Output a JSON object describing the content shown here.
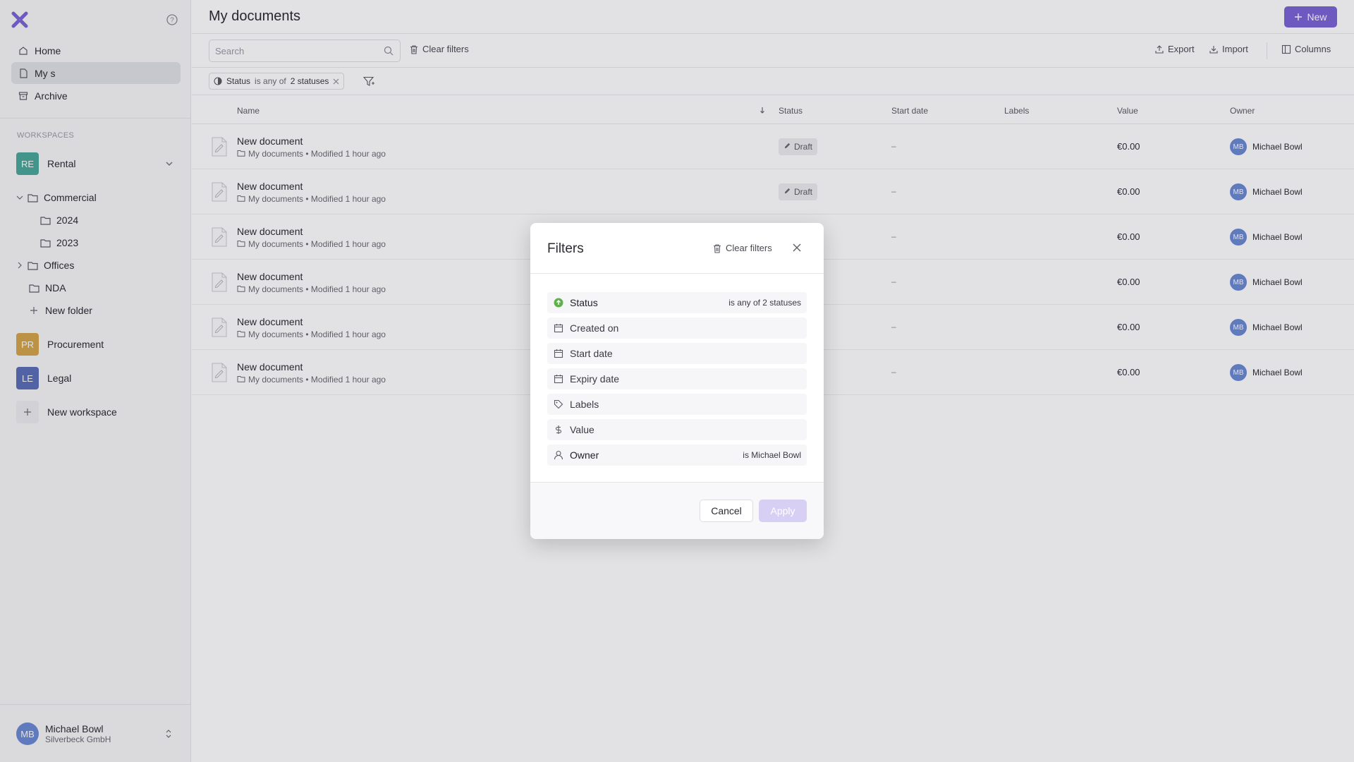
{
  "sidebar": {
    "nav": [
      {
        "label": "Home",
        "icon": "home-icon"
      },
      {
        "label": "My s",
        "icon": "document-icon",
        "active": true
      },
      {
        "label": "Archive",
        "icon": "archive-icon"
      }
    ],
    "workspaces_label": "WORKSPACES",
    "workspaces": [
      {
        "initials": "RE",
        "name": "Rental",
        "color": "#4aa89a"
      },
      {
        "initials": "PR",
        "name": "Procurement",
        "color": "#d4a64a"
      },
      {
        "initials": "LE",
        "name": "Legal",
        "color": "#5a6fb8"
      }
    ],
    "folders": {
      "commercial": "Commercial",
      "y2024": "2024",
      "y2023": "2023",
      "offices": "Offices",
      "nda": "NDA",
      "new_folder": "New folder"
    },
    "new_workspace": "New workspace",
    "user": {
      "initials": "MB",
      "name": "Michael Bowl",
      "company": "Silverbeck GmbH"
    }
  },
  "header": {
    "title": "My documents",
    "new_label": "New"
  },
  "toolbar": {
    "search_placeholder": "Search",
    "clear_filters": "Clear filters",
    "export": "Export",
    "import": "Import",
    "columns": "Columns"
  },
  "active_filter": {
    "field": "Status",
    "op": "is any of",
    "value": "2 statuses"
  },
  "table": {
    "columns": {
      "name": "Name",
      "status": "Status",
      "start_date": "Start date",
      "labels": "Labels",
      "value": "Value",
      "owner": "Owner"
    },
    "rows": [
      {
        "name": "New document",
        "meta": "My documents • Modified 1 hour ago",
        "status": "Draft",
        "start": "–",
        "value": "€0.00",
        "owner_initials": "MB",
        "owner": "Michael Bowl"
      },
      {
        "name": "New document",
        "meta": "My documents • Modified 1 hour ago",
        "status": "Draft",
        "start": "–",
        "value": "€0.00",
        "owner_initials": "MB",
        "owner": "Michael Bowl"
      },
      {
        "name": "New document",
        "meta": "My documents • Modified 1 hour ago",
        "status": "",
        "start": "–",
        "value": "€0.00",
        "owner_initials": "MB",
        "owner": "Michael Bowl"
      },
      {
        "name": "New document",
        "meta": "My documents • Modified 1 hour ago",
        "status": "",
        "start": "–",
        "value": "€0.00",
        "owner_initials": "MB",
        "owner": "Michael Bowl"
      },
      {
        "name": "New document",
        "meta": "My documents • Modified 1 hour ago",
        "status": "",
        "start": "–",
        "value": "€0.00",
        "owner_initials": "MB",
        "owner": "Michael Bowl"
      },
      {
        "name": "New document",
        "meta": "My documents • Modified 1 hour ago",
        "status": "",
        "start": "–",
        "value": "€0.00",
        "owner_initials": "MB",
        "owner": "Michael Bowl"
      }
    ]
  },
  "modal": {
    "title": "Filters",
    "clear_filters": "Clear filters",
    "filters": [
      {
        "label": "Status",
        "icon": "status-icon",
        "value": "is any of 2 statuses",
        "active": true
      },
      {
        "label": "Created on",
        "icon": "calendar-icon",
        "value": ""
      },
      {
        "label": "Start date",
        "icon": "calendar-icon",
        "value": ""
      },
      {
        "label": "Expiry date",
        "icon": "calendar-icon",
        "value": ""
      },
      {
        "label": "Labels",
        "icon": "tag-icon",
        "value": ""
      },
      {
        "label": "Value",
        "icon": "dollar-icon",
        "value": ""
      },
      {
        "label": "Owner",
        "icon": "user-icon",
        "value": "is Michael Bowl",
        "active": true
      }
    ],
    "cancel": "Cancel",
    "apply": "Apply"
  },
  "colors": {
    "accent": "#7b64d8",
    "status_green": "#5fb04a",
    "avatar": "#6a8ad4"
  }
}
